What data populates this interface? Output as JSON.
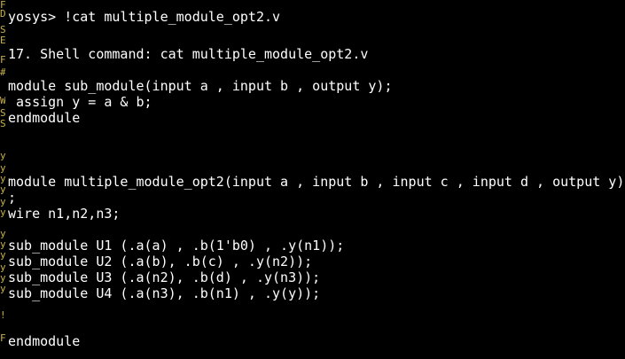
{
  "terminal": {
    "prompt": "yosys>",
    "command": "!cat multiple_module_opt2.v",
    "lines": [
      "yosys> !cat multiple_module_opt2.v",
      "",
      "17. Shell command: cat multiple_module_opt2.v",
      "",
      "module sub_module(input a , input b , output y);",
      " assign y = a & b;",
      "endmodule",
      "",
      "",
      "",
      "module multiple_module_opt2(input a , input b , input c , input d , output y)",
      ";",
      "wire n1,n2,n3;",
      "",
      "sub_module U1 (.a(a) , .b(1'b0) , .y(n1));",
      "sub_module U2 (.a(b), .b(c) , .y(n2));",
      "sub_module U3 (.a(n2), .b(d) , .y(n3));",
      "sub_module U4 (.a(n3), .b(n1) , .y(y));",
      "",
      "",
      "endmodule"
    ],
    "gutter_marks": [
      "F",
      "D",
      "S",
      "E",
      "F",
      "#",
      "W",
      "S",
      "S",
      "y",
      "y",
      "y",
      "y",
      "y",
      "y",
      "y",
      "y",
      "y",
      "y",
      "y",
      "y",
      "!",
      "F"
    ],
    "colors": {
      "background": "#000000",
      "text": "#ffffff",
      "gutter": "#c8b14a"
    }
  }
}
